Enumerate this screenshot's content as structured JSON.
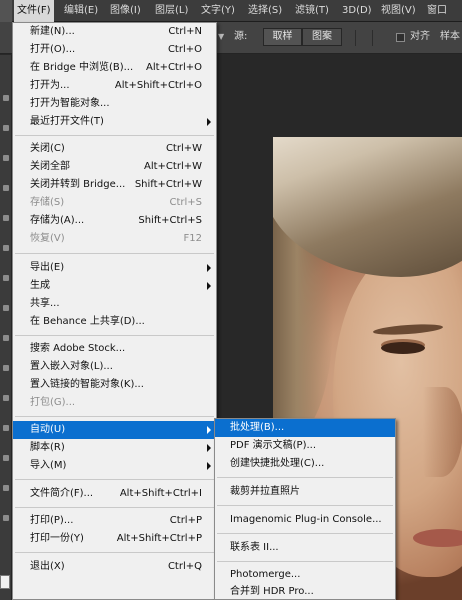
{
  "menubar": {
    "items": [
      {
        "label": "文件(F)",
        "active": true
      },
      {
        "label": "编辑(E)",
        "active": false
      },
      {
        "label": "图像(I)",
        "active": false
      },
      {
        "label": "图层(L)",
        "active": false
      },
      {
        "label": "文字(Y)",
        "active": false
      },
      {
        "label": "选择(S)",
        "active": false
      },
      {
        "label": "滤镜(T)",
        "active": false
      },
      {
        "label": "3D(D)",
        "active": false
      },
      {
        "label": "视图(V)",
        "active": false
      },
      {
        "label": "窗口",
        "active": false
      }
    ]
  },
  "options": {
    "source_label": "源:",
    "seg_sample": "取样",
    "seg_pattern": "图案",
    "align_label": "对齐",
    "sample_label": "样本"
  },
  "file_menu": {
    "items": [
      {
        "label": "新建(N)...",
        "shortcut": "Ctrl+N",
        "submenu": false,
        "disabled": false
      },
      {
        "label": "打开(O)...",
        "shortcut": "Ctrl+O",
        "submenu": false,
        "disabled": false
      },
      {
        "label": "在 Bridge 中浏览(B)...",
        "shortcut": "Alt+Ctrl+O",
        "submenu": false,
        "disabled": false
      },
      {
        "label": "打开为...",
        "shortcut": "Alt+Shift+Ctrl+O",
        "submenu": false,
        "disabled": false
      },
      {
        "label": "打开为智能对象...",
        "shortcut": "",
        "submenu": false,
        "disabled": false
      },
      {
        "label": "最近打开文件(T)",
        "shortcut": "",
        "submenu": true,
        "disabled": false
      },
      {
        "label": "关闭(C)",
        "shortcut": "Ctrl+W",
        "submenu": false,
        "disabled": false
      },
      {
        "label": "关闭全部",
        "shortcut": "Alt+Ctrl+W",
        "submenu": false,
        "disabled": false
      },
      {
        "label": "关闭并转到 Bridge...",
        "shortcut": "Shift+Ctrl+W",
        "submenu": false,
        "disabled": false
      },
      {
        "label": "存储(S)",
        "shortcut": "Ctrl+S",
        "submenu": false,
        "disabled": true
      },
      {
        "label": "存储为(A)...",
        "shortcut": "Shift+Ctrl+S",
        "submenu": false,
        "disabled": false
      },
      {
        "label": "恢复(V)",
        "shortcut": "F12",
        "submenu": false,
        "disabled": true
      },
      {
        "label": "导出(E)",
        "shortcut": "",
        "submenu": true,
        "disabled": false
      },
      {
        "label": "生成",
        "shortcut": "",
        "submenu": true,
        "disabled": false
      },
      {
        "label": "共享...",
        "shortcut": "",
        "submenu": false,
        "disabled": false
      },
      {
        "label": "在 Behance 上共享(D)...",
        "shortcut": "",
        "submenu": false,
        "disabled": false
      },
      {
        "label": "搜索 Adobe Stock...",
        "shortcut": "",
        "submenu": false,
        "disabled": false
      },
      {
        "label": "置入嵌入对象(L)...",
        "shortcut": "",
        "submenu": false,
        "disabled": false
      },
      {
        "label": "置入链接的智能对象(K)...",
        "shortcut": "",
        "submenu": false,
        "disabled": false
      },
      {
        "label": "打包(G)...",
        "shortcut": "",
        "submenu": false,
        "disabled": true
      },
      {
        "label": "自动(U)",
        "shortcut": "",
        "submenu": true,
        "disabled": false,
        "highlight": true
      },
      {
        "label": "脚本(R)",
        "shortcut": "",
        "submenu": true,
        "disabled": false
      },
      {
        "label": "导入(M)",
        "shortcut": "",
        "submenu": true,
        "disabled": false
      },
      {
        "label": "文件简介(F)...",
        "shortcut": "Alt+Shift+Ctrl+I",
        "submenu": false,
        "disabled": false
      },
      {
        "label": "打印(P)...",
        "shortcut": "Ctrl+P",
        "submenu": false,
        "disabled": false
      },
      {
        "label": "打印一份(Y)",
        "shortcut": "Alt+Shift+Ctrl+P",
        "submenu": false,
        "disabled": false
      },
      {
        "label": "退出(X)",
        "shortcut": "Ctrl+Q",
        "submenu": false,
        "disabled": false
      }
    ]
  },
  "automate_menu": {
    "items": [
      {
        "label": "批处理(B)...",
        "highlight": true
      },
      {
        "label": "PDF 演示文稿(P)..."
      },
      {
        "label": "创建快捷批处理(C)..."
      },
      {
        "label": "裁剪并拉直照片"
      },
      {
        "label": "Imagenomic Plug-in Console..."
      },
      {
        "label": "联系表 II..."
      },
      {
        "label": "Photomerge..."
      },
      {
        "label": "合并到 HDR Pro..."
      }
    ]
  },
  "colors": {
    "highlight": "#0b6fcf",
    "menu_bg": "#f0f0f0",
    "app_bg": "#282828"
  }
}
